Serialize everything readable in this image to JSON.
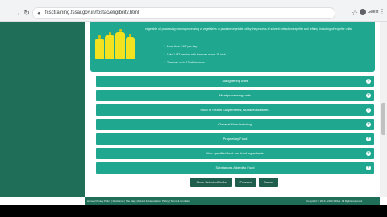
{
  "browser": {
    "url": "fcsctraining.fssai.gov.in/fostac/eligibility.html",
    "profile_label": "Guest",
    "icons": {
      "back": "arrow-left-icon",
      "forward": "arrow-right-icon",
      "reload": "reload-icon",
      "lock": "lock-icon",
      "star": "star-icon",
      "menu": "more-vert-icon"
    }
  },
  "info_card": {
    "description": "vegetable oil processing means processing of vegetables to produce vegetable oil by the process of solvent extraction/expeller and refining including oil expeller units",
    "bullets": [
      "More than 2 MT per day",
      "Upto 1 MT per day with turnover above 12 lakh",
      "Turnover up to 12 lakh/annum"
    ]
  },
  "accordion": [
    {
      "label": "Slaughtering units"
    },
    {
      "label": "Meat processing units"
    },
    {
      "label": "Food or Health Supplements, Nutraceuticals etc."
    },
    {
      "label": "General Manufacturing"
    },
    {
      "label": "Proprietary Food"
    },
    {
      "label": "Non specified food and food ingredients"
    },
    {
      "label": "Substances Added to Food"
    }
  ],
  "buttons": {
    "clear": "Clear Selected KoBs",
    "proceed": "Proceed",
    "cancel": "Cancel"
  },
  "footer": {
    "links": "Home | Privacy Policy | Disclaimer | Site Map | Refund & Cancellation Policy | Terms & Condition",
    "copyright": "Copyright © 2019 - 2020 FSSAI. All Rights reserved."
  },
  "colors": {
    "teal": "#1fa88f",
    "dark_green": "#1f6e57",
    "button_dark": "#1f5e4d"
  }
}
